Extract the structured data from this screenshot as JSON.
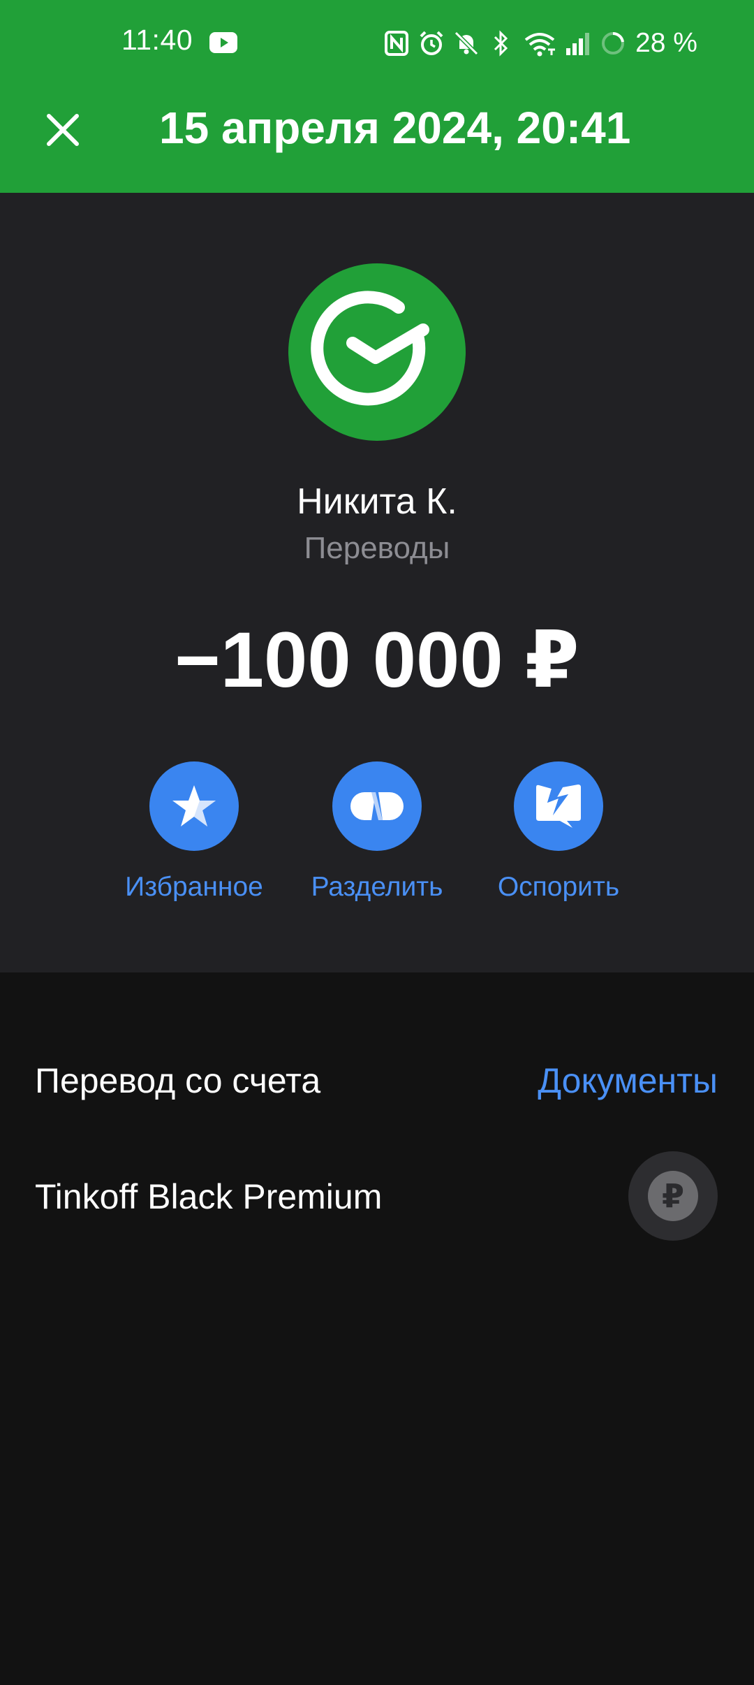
{
  "status_bar": {
    "time": "11:40",
    "battery": "28 %",
    "icons": [
      "youtube-icon",
      "nfc-icon",
      "alarm-icon",
      "bell-off-icon",
      "bluetooth-icon",
      "wifi-icon",
      "signal-icon",
      "battery-icon"
    ]
  },
  "header": {
    "title": "15 апреля 2024, 20:41",
    "close_icon": "close-icon"
  },
  "transaction": {
    "payee": "Никита К.",
    "category": "Переводы",
    "amount": "−100 000 ₽",
    "logo_icon": "sber-logo-icon"
  },
  "actions": [
    {
      "label": "Избранное",
      "icon": "star-icon"
    },
    {
      "label": "Разделить",
      "icon": "split-icon"
    },
    {
      "label": "Оспорить",
      "icon": "dispute-icon"
    }
  ],
  "details": {
    "section_title": "Перевод со счета",
    "documents_link": "Документы",
    "account_name": "Tinkoff Black Premium",
    "account_currency_symbol": "₽"
  },
  "colors": {
    "brand_green": "#21a038",
    "action_blue": "#3a85f0",
    "link_blue": "#4a90f5",
    "card_bg": "#212124",
    "page_bg": "#121212"
  }
}
